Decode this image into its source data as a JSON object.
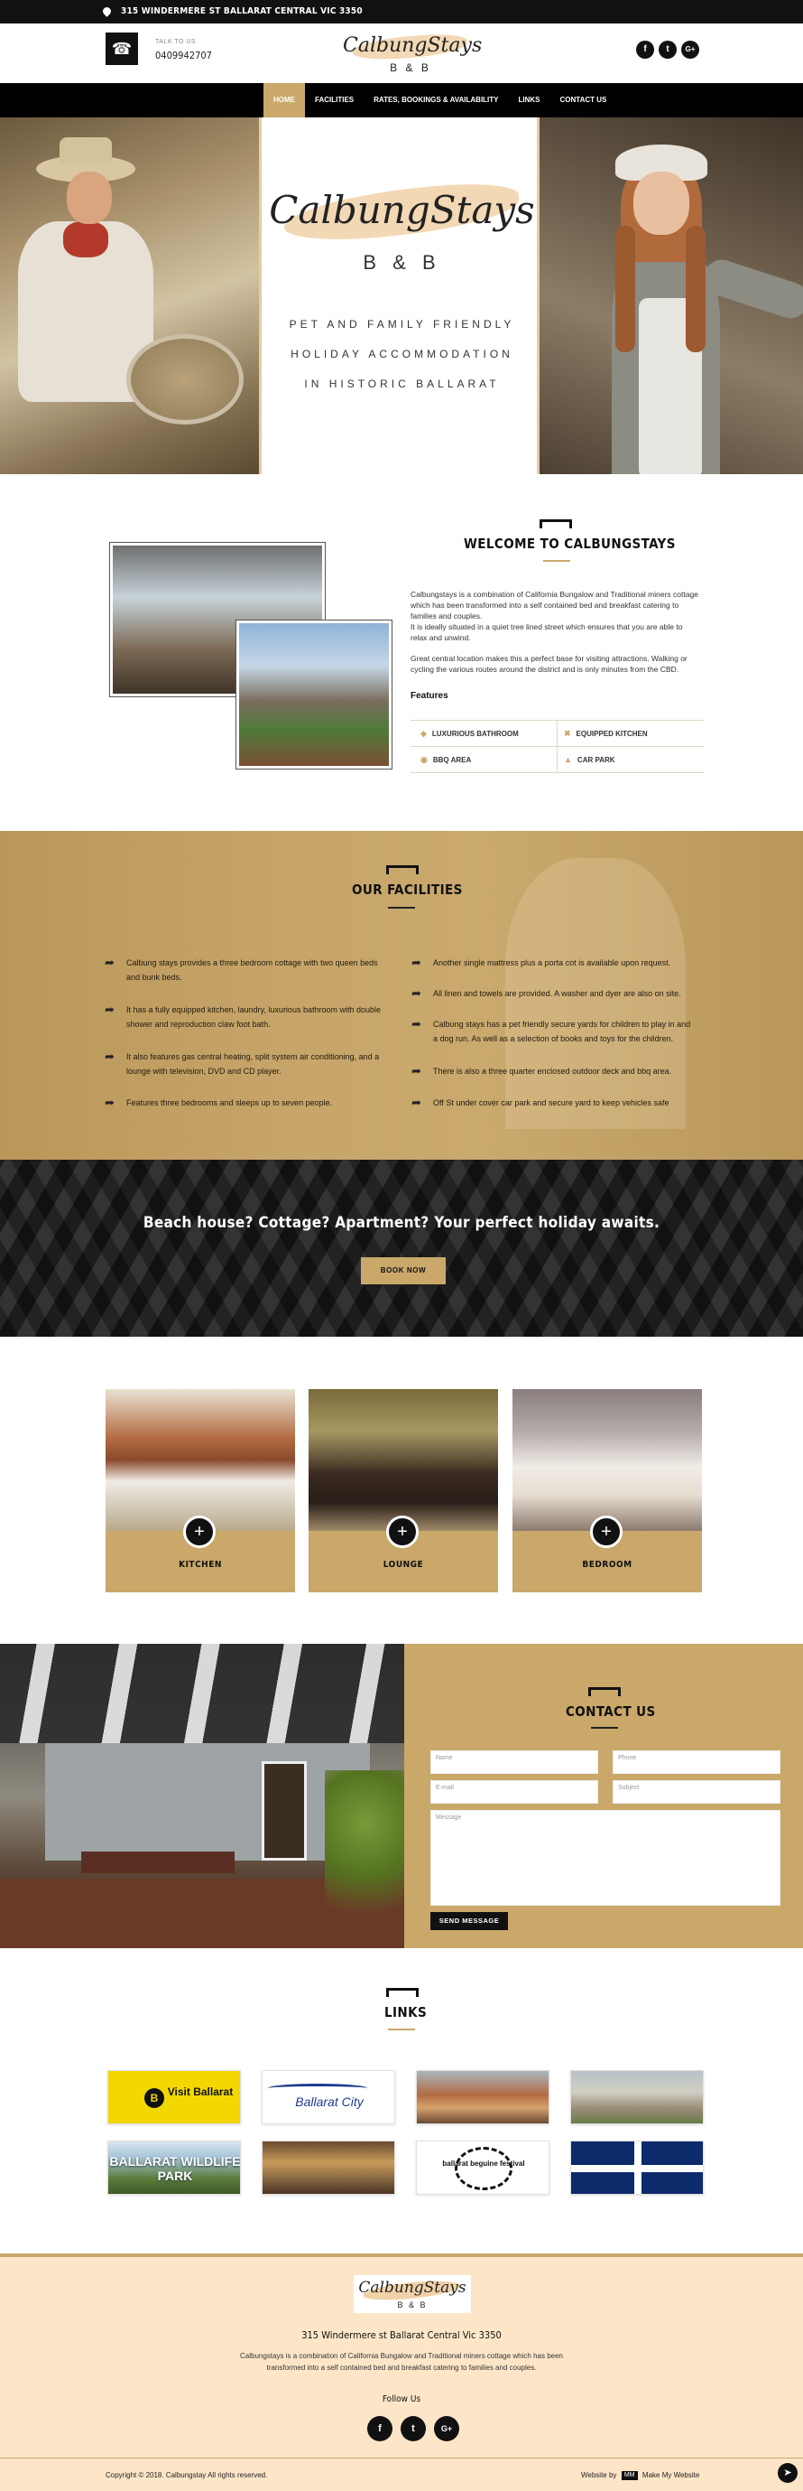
{
  "topbar": {
    "address": "315 WINDERMERE ST BALLARAT CENTRAL VIC 3350"
  },
  "header": {
    "talk_label": "TALK TO US",
    "phone": "0409942707",
    "logo_name": "CalbungStays",
    "logo_sub": "B & B",
    "social": [
      "f",
      "t",
      "G+"
    ]
  },
  "nav": {
    "items": [
      "HOME",
      "FACILITIES",
      "RATES, BOOKINGS & AVAILABILITY",
      "LINKS",
      "CONTACT US"
    ],
    "active": 0
  },
  "hero": {
    "logo_name": "CalbungStays",
    "logo_sub": "B & B",
    "tagline": [
      "PET AND FAMILY FRIENDLY",
      "HOLIDAY ACCOMMODATION",
      "IN HISTORIC BALLARAT"
    ]
  },
  "welcome": {
    "title": "WELCOME TO CALBUNGSTAYS",
    "paragraphs": [
      "Calbungstays is a combination of California Bungalow and Traditional miners cottage which has been transformed into a self contained bed and breakfast catering to families and couples.",
      "It is ideally situated in a quiet tree lined street which ensures that you are able to relax and unwind.",
      "Great central location makes this a perfect base for visiting attractions. Walking or cycling the various routes around the district and is only minutes from the CBD."
    ],
    "features_heading": "Features",
    "features": [
      "LUXURIOUS BATHROOM",
      "EQUIPPED KITCHEN",
      "BBQ AREA",
      "CAR PARK"
    ]
  },
  "facilities": {
    "title": "OUR FACILITIES",
    "left": [
      "Calbung stays provides a three bedroom cottage with two queen beds and bunk beds.",
      "It has a fully equipped kitchen, laundry, luxurious bathroom with double shower and reproduction claw foot bath.",
      "It also features gas central heating, split system air conditioning, and a lounge with television, DVD and CD player.",
      "Features three bedrooms and sleeps up to seven people."
    ],
    "right": [
      "Another single mattress plus a porta cot is available upon request.",
      "All linen and towels are provided. A washer and dyer are also on site.",
      "Calbung stays has a pet friendly secure yards for children to play in and a dog run. As well as a selection of books and toys for the children.",
      "There is also a three quarter enclosed outdoor deck and bbq area.",
      "Off St under cover car park and secure yard to keep vehicles safe"
    ]
  },
  "cta": {
    "title": "Beach house? Cottage? Apartment? Your perfect holiday awaits.",
    "button": "BOOK NOW"
  },
  "rooms": [
    {
      "label": "KITCHEN"
    },
    {
      "label": "LOUNGE"
    },
    {
      "label": "BEDROOM"
    }
  ],
  "contact": {
    "title": "CONTACT US",
    "placeholders": {
      "name": "Name",
      "phone": "Phone",
      "email": "E-mail",
      "subject": "Subject",
      "message": "Message"
    },
    "send": "SEND MESSAGE"
  },
  "links": {
    "title": "LINKS",
    "items": [
      "Visit Ballarat",
      "Ballarat City",
      "",
      "",
      "BALLARAT WILDLIFE PARK",
      "",
      "ballarat beguine festival",
      ""
    ]
  },
  "footer": {
    "logo_name": "CalbungStays",
    "logo_sub": "B & B",
    "address": "315 Windermere st Ballarat Central Vic 3350",
    "desc": [
      "Calbungstays is a combination of California Bungalow and Traditional miners cottage which has been",
      "transformed into a self contained bed and breakfast catering to families and couples."
    ],
    "follow": "Follow Us",
    "social": [
      "f",
      "t",
      "G+"
    ],
    "copyright": "Copyright © 2018. Calbungstay All rights reserved.",
    "made_prefix": "Website by",
    "made_brand": "MM",
    "made_suffix": "Make My Website"
  },
  "colors": {
    "gold": "#c9a86a",
    "dark": "#111111",
    "cream": "#fde6c8"
  }
}
